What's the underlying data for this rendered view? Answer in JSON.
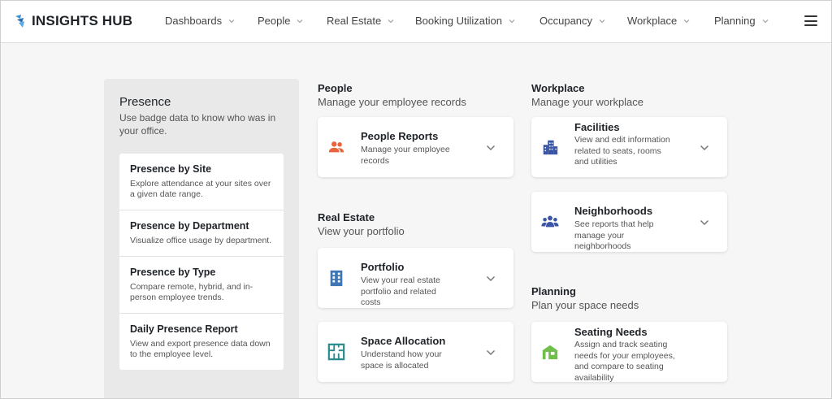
{
  "brand": {
    "name": "INSIGHTS HUB"
  },
  "nav": [
    {
      "label": "Dashboards"
    },
    {
      "label": "People"
    },
    {
      "label": "Real Estate"
    },
    {
      "label": "Booking Utilization"
    },
    {
      "label": "Occupancy"
    },
    {
      "label": "Workplace"
    },
    {
      "label": "Planning"
    }
  ],
  "presence": {
    "title": "Presence",
    "desc": "Use badge data to know who was in your office.",
    "items": [
      {
        "title": "Presence by Site",
        "desc": "Explore attendance at your sites over a given date range."
      },
      {
        "title": "Presence by Department",
        "desc": "Visualize office usage by department."
      },
      {
        "title": "Presence by Type",
        "desc": "Compare remote, hybrid, and in-person employee trends."
      },
      {
        "title": "Daily Presence Report",
        "desc": "View and export presence data down to the employee level."
      }
    ]
  },
  "people": {
    "title": "People",
    "sub": "Manage your employee records",
    "cards": [
      {
        "title": "People Reports",
        "desc": "Manage your employee records",
        "icon": "people-icon"
      }
    ]
  },
  "real_estate": {
    "title": "Real Estate",
    "sub": "View your portfolio",
    "cards": [
      {
        "title": "Portfolio",
        "desc": "View your real estate portfolio and related costs",
        "icon": "building-icon"
      },
      {
        "title": "Space Allocation",
        "desc": "Understand how your space is allocated",
        "icon": "floorplan-icon"
      }
    ]
  },
  "workplace": {
    "title": "Workplace",
    "sub": "Manage your workplace",
    "cards": [
      {
        "title": "Facilities",
        "desc": "View and edit information related to seats, rooms and utilities",
        "icon": "city-icon"
      },
      {
        "title": "Neighborhoods",
        "desc": "See reports that help manage your neighborhoods",
        "icon": "group-icon"
      }
    ]
  },
  "planning": {
    "title": "Planning",
    "sub": "Plan your space needs",
    "cards": [
      {
        "title": "Seating Needs",
        "desc": "Assign and track seating needs for your employees, and compare to seating availability",
        "icon": "house-icon"
      }
    ]
  },
  "colors": {
    "people_icon": "#e8643c",
    "building_icon": "#3f76b5",
    "floorplan_icon": "#2a8a8c",
    "city_icon": "#3b55a6",
    "group_icon": "#3b55a6",
    "house_icon": "#6fbf4a"
  }
}
